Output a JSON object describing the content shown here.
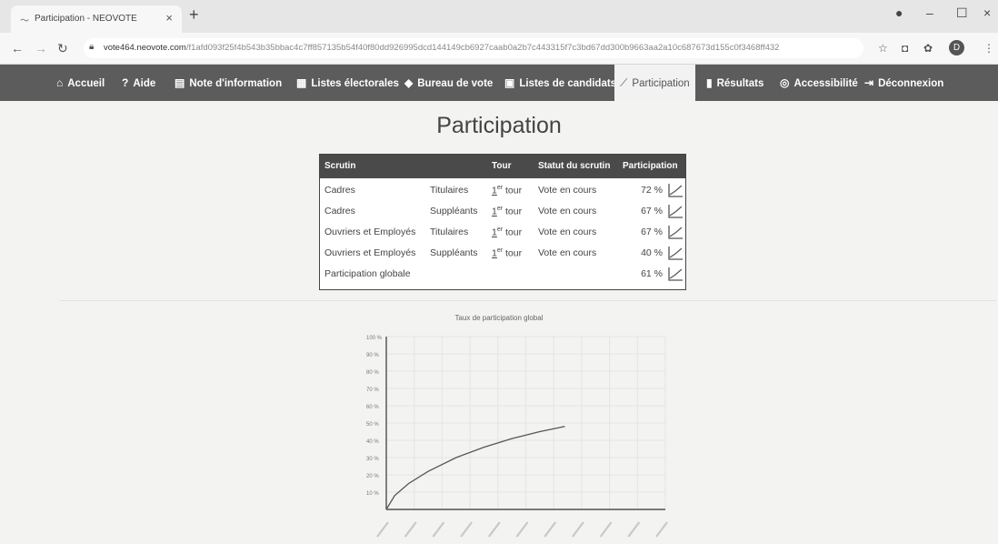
{
  "browser": {
    "tab_title": "Participation - NEOVOTE",
    "url_host": "vote464.neovote.com",
    "url_path": "/f1afd093f25f4b543b35bbac4c7ff857135b54f40f80dd926995dcd144149cb6927caab0a2b7c443315f7c3bd67dd300b9663aa2a10c687673d155c0f3468ff432",
    "avatar_letter": "D"
  },
  "nav": {
    "items": [
      {
        "icon": "⌂",
        "label": "Accueil"
      },
      {
        "icon": "?",
        "label": "Aide"
      },
      {
        "icon": "▤",
        "label": "Note d'information"
      },
      {
        "icon": "▦",
        "label": "Listes électorales"
      },
      {
        "icon": "◆",
        "label": "Bureau de vote"
      },
      {
        "icon": "▣",
        "label": "Listes de candidats"
      },
      {
        "icon": "⟋",
        "label": "Participation"
      },
      {
        "icon": "▮",
        "label": "Résultats"
      },
      {
        "icon": "◎",
        "label": "Accessibilité"
      },
      {
        "icon": "⇥",
        "label": "Déconnexion"
      }
    ],
    "active": "Participation"
  },
  "page": {
    "title": "Participation"
  },
  "table": {
    "headers": [
      "Scrutin",
      "Tour",
      "Statut du scrutin",
      "Participation"
    ],
    "rows": [
      {
        "scrutin": "Cadres",
        "college": "Titulaires",
        "tour_num": "1",
        "tour_sup": "er",
        "tour_word": "tour",
        "statut": "Vote en cours",
        "participation": "72 %"
      },
      {
        "scrutin": "Cadres",
        "college": "Suppléants",
        "tour_num": "1",
        "tour_sup": "er",
        "tour_word": "tour",
        "statut": "Vote en cours",
        "participation": "67 %"
      },
      {
        "scrutin": "Ouvriers et Employés",
        "college": "Titulaires",
        "tour_num": "1",
        "tour_sup": "er",
        "tour_word": "tour",
        "statut": "Vote en cours",
        "participation": "67 %"
      },
      {
        "scrutin": "Ouvriers et Employés",
        "college": "Suppléants",
        "tour_num": "1",
        "tour_sup": "er",
        "tour_word": "tour",
        "statut": "Vote en cours",
        "participation": "40 %"
      },
      {
        "scrutin": "Participation globale",
        "college": "",
        "tour_num": "",
        "tour_sup": "",
        "tour_word": "",
        "statut": "",
        "participation": "61 %"
      }
    ]
  },
  "chart_data": {
    "type": "line",
    "title": "Taux de participation global",
    "ylim": [
      0,
      100
    ],
    "yticks": [
      "10 %",
      "20 %",
      "30 %",
      "40 %",
      "50 %",
      "60 %",
      "70 %",
      "80 %",
      "90 %",
      "100 %"
    ],
    "x_tick_count": 11,
    "grid": true,
    "series": [
      {
        "x_tick_index": [
          0,
          0.3,
          0.8,
          1.5,
          2.5,
          3.5,
          4.5,
          5.5,
          6.4
        ],
        "values": [
          0,
          8,
          15,
          22,
          30,
          36,
          41,
          45,
          48
        ]
      }
    ],
    "line_color": "#555555"
  }
}
